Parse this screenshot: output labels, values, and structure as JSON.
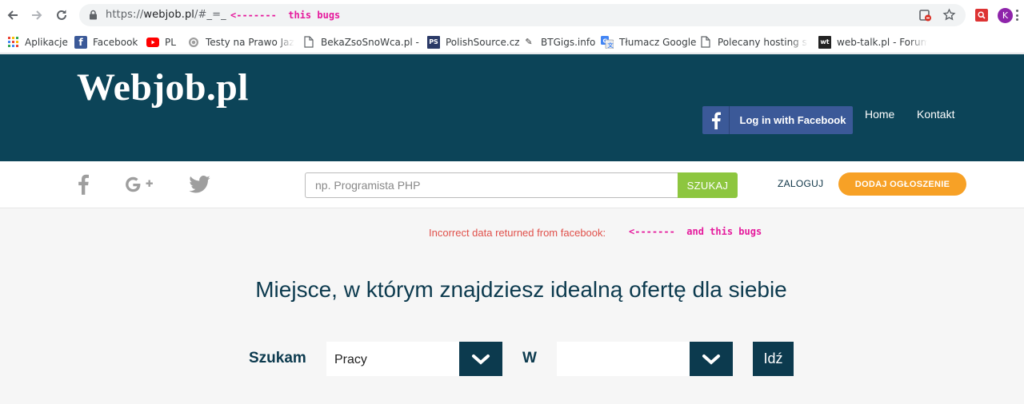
{
  "browser": {
    "url_prefix": "https://",
    "url_host": "webjob.pl",
    "url_rest": "/#_=_",
    "annotation_url": "<-------  this bugs",
    "bookmarks": [
      {
        "label": "Aplikacje",
        "icon": "apps-grid-icon"
      },
      {
        "label": "Facebook",
        "icon": "facebook-icon"
      },
      {
        "label": "PL",
        "icon": "youtube-icon"
      },
      {
        "label": "Testy na Prawo Jazdy",
        "icon": "globe-icon"
      },
      {
        "label": "BekaZsoSnoWca.pl -",
        "icon": "page-icon"
      },
      {
        "label": "PolishSource.cz",
        "icon": "ps-icon"
      },
      {
        "label": "BTGigs.info",
        "icon": "btgigs-icon"
      },
      {
        "label": "Tłumacz Google",
        "icon": "translate-icon"
      },
      {
        "label": "Polecany hosting stro",
        "icon": "page-icon"
      },
      {
        "label": "web-talk.pl - Forum w",
        "icon": "wt-icon"
      }
    ],
    "profile_initial": "K"
  },
  "site": {
    "logo": "Webjob.pl",
    "fb_login": "Log in with Facebook",
    "nav": [
      "Home",
      "Kontakt"
    ],
    "search_placeholder": "np. Programista PHP",
    "search_button": "SZUKAJ",
    "login": "ZALOGUJ",
    "add_offer": "DODAJ OGŁOSZENIE",
    "error_message": "Incorrect data returned from facebook:",
    "annotation_error": "<-------  and this bugs",
    "headline": "Miejsce, w którym znajdziesz idealną ofertę dla siebie",
    "form": {
      "label_search": "Szukam",
      "select_type_value": "Pracy",
      "label_in": "W",
      "select_location_value": "",
      "go_button": "Idź"
    }
  },
  "colors": {
    "header_bg": "#0c4458",
    "facebook_blue": "#3b5998",
    "search_green": "#8dc63f",
    "add_orange": "#f7a126",
    "error_red": "#e0504a",
    "annotation_pink": "#e5199c"
  }
}
